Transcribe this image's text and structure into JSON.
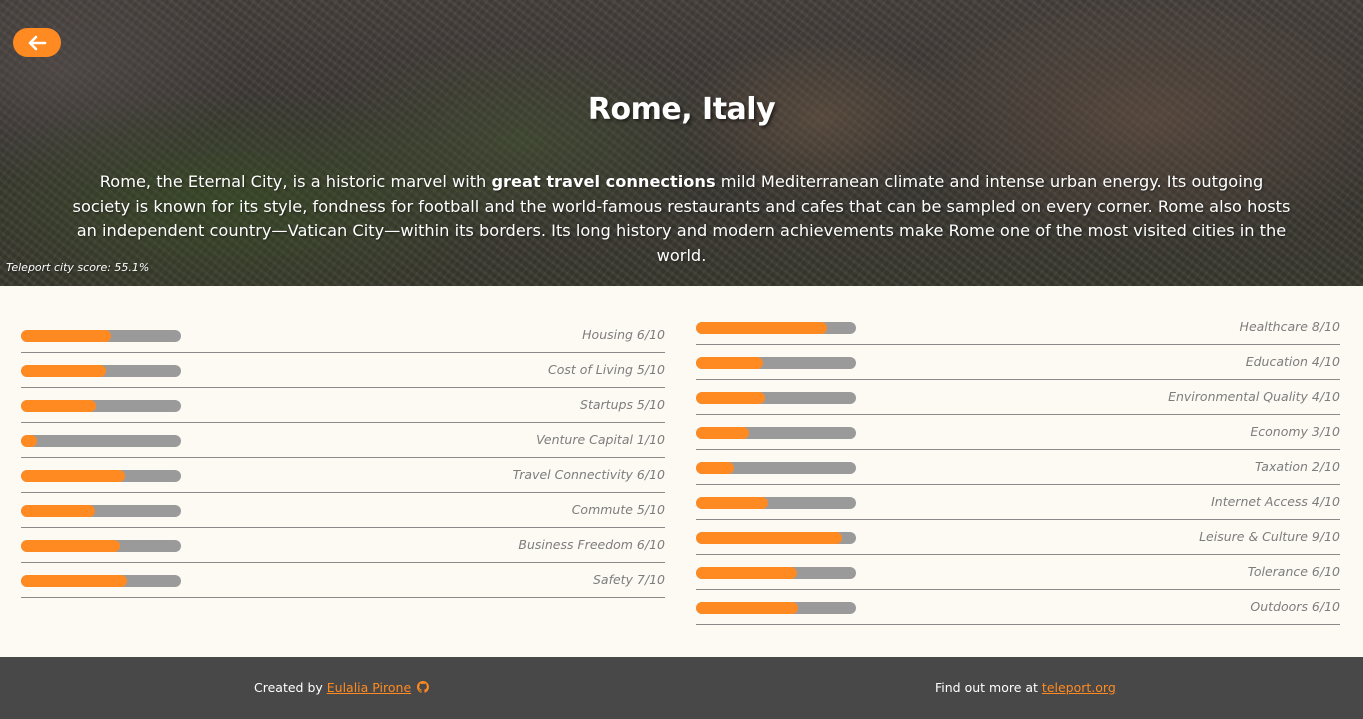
{
  "header": {
    "back_icon": "arrow-left-icon",
    "title": "Rome, Italy",
    "description_parts": {
      "before": "Rome, the Eternal City, is a historic marvel with ",
      "bold": "great travel connections",
      "after": " mild Mediterranean climate and intense urban energy. Its outgoing society is known for its style, fondness for football and the world-famous restaurants and cafes that can be sampled on every corner. Rome also hosts an independent country—Vatican City—within its borders. Its long history and modern achievements make Rome one of the most visited cities in the world."
    },
    "score": "Teleport city score: 55.1%"
  },
  "colors": {
    "accent": "#ff8a22",
    "bar_track": "#9a9a9a",
    "footer_bg": "#484848",
    "page_bg": "#fdfaf4"
  },
  "categories_left": [
    {
      "label": "Housing 6/10",
      "score": 0.56
    },
    {
      "label": "Cost of Living 5/10",
      "score": 0.53
    },
    {
      "label": "Startups 5/10",
      "score": 0.47
    },
    {
      "label": "Venture Capital 1/10",
      "score": 0.1
    },
    {
      "label": "Travel Connectivity 6/10",
      "score": 0.65
    },
    {
      "label": "Commute 5/10",
      "score": 0.46
    },
    {
      "label": "Business Freedom 6/10",
      "score": 0.62
    },
    {
      "label": "Safety 7/10",
      "score": 0.66
    }
  ],
  "categories_right": [
    {
      "label": "Healthcare 8/10",
      "score": 0.82
    },
    {
      "label": "Education 4/10",
      "score": 0.42
    },
    {
      "label": "Environmental Quality 4/10",
      "score": 0.43
    },
    {
      "label": "Economy 3/10",
      "score": 0.33
    },
    {
      "label": "Taxation 2/10",
      "score": 0.24
    },
    {
      "label": "Internet Access 4/10",
      "score": 0.45
    },
    {
      "label": "Leisure & Culture 9/10",
      "score": 0.91
    },
    {
      "label": "Tolerance 6/10",
      "score": 0.63
    },
    {
      "label": "Outdoors 6/10",
      "score": 0.64
    }
  ],
  "footer": {
    "created_by": "Created by ",
    "author": "Eulalia Pirone",
    "github_icon": "github-icon",
    "find_more": "Find out more at ",
    "link": "teleport.org"
  }
}
